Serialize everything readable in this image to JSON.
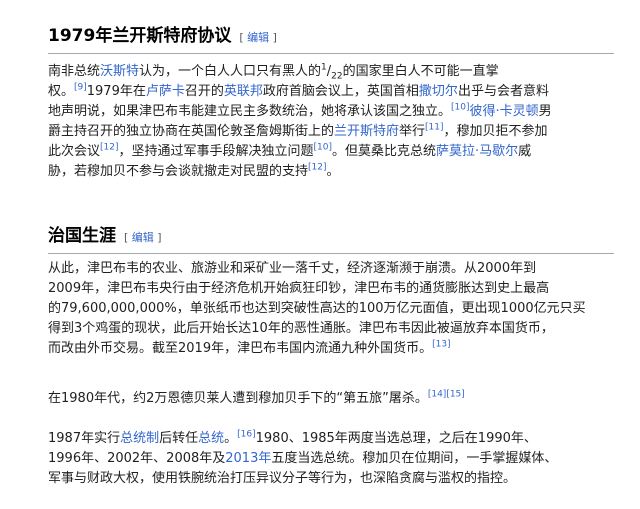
{
  "section1": {
    "title": "1979年兰开斯特府协议",
    "edit_label": "编辑",
    "bracket_left": "[",
    "bracket_right": "]",
    "lines": [
      {
        "text_a": "南非总统",
        "link_a": "沃斯特",
        "text_b": "认为，一个白人人口只有黑人的",
        "frac_num": "1",
        "frac_slash": "/",
        "frac_den": "22",
        "text_c": "的国家里白人不可能一直掌"
      },
      {
        "text_a": "权。",
        "ref_a": "[9]",
        "text_b": "1979年在",
        "link_a": "卢萨卡",
        "text_c": "召开的",
        "link_b": "英联邦",
        "text_d": "政府首脑会议上，英国首相",
        "link_c": "撒切尔",
        "text_e": "出乎与会者意料"
      },
      {
        "text_a": "地声明说，如果津巴布韦能建立民主多数统治，她将承认该国之独立。",
        "ref_a": "[10]",
        "link_a": "彼得·卡灵顿",
        "text_b": "男"
      },
      {
        "text_a": "爵主持召开的独立协商在英国伦敦圣詹姆斯街上的",
        "link_a": "兰开斯特府",
        "text_b": "举行",
        "ref_a": "[11]",
        "text_c": "，穆加贝拒不参加"
      },
      {
        "text_a": "此次会议",
        "ref_a": "[12]",
        "text_b": "，坚持通过军事手段解决独立问题",
        "ref_b": "[10]",
        "text_c": "。但莫桑比克总统",
        "link_a": "萨莫拉·马歇尔",
        "text_d": "威"
      },
      {
        "text_a": "胁，若穆加贝不参与会谈就撤走对民盟的支持",
        "ref_a": "[12]",
        "text_b": "。"
      }
    ]
  },
  "section2": {
    "title": "治国生涯",
    "edit_label": "编辑",
    "bracket_left": "[",
    "bracket_right": "]",
    "para1": [
      "从此，津巴布韦的农业、旅游业和采矿业一落千丈，经济逐渐濒于崩溃。从2000年到",
      "2009年，津巴布韦央行由于经济危机开始疯狂印钞，津巴布韦的通货膨胀达到史上最高",
      "的79,600,000,000%，单张纸币也达到突破性高达的100万亿元面值，更出现1000亿元只买",
      "得到3个鸡蛋的现状，此后开始长达10年的恶性通胀。津巴布韦因此被逼放弃本国货币，"
    ],
    "para1_last": {
      "text_a": "而改由外币交易。截至2019年，津巴布韦国内流通九种外国货币。",
      "ref_a": "[13]"
    },
    "para2": {
      "text_a": "在1980年代，约2万恩德贝莱人遭到穆加贝手下的“第五旅”屠杀。",
      "ref_a": "[14]",
      "ref_b": "[15]"
    },
    "para3": [
      {
        "text_a": "1987年实行",
        "link_a": "总统制",
        "text_b": "后转任",
        "link_b": "总统",
        "text_c": "。",
        "ref_a": "[16]",
        "text_d": "1980、1985年两度当选总理，之后在1990年、"
      },
      {
        "text_a": "1996年、2002年、2008年及",
        "link_a": "2013年",
        "text_b": "五度当选总统。穆加贝在位期间，一手掌握媒体、"
      },
      {
        "text_a": "军事与财政大权，使用铁腕统治打压异议分子等行为，也深陷贪腐与滥权的指控。"
      }
    ]
  }
}
